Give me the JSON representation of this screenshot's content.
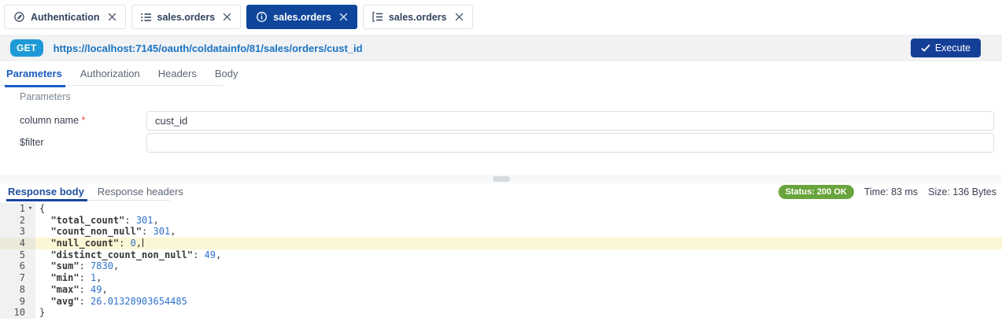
{
  "colors": {
    "active_tab_blue": "#0f469c",
    "get_badge_blue": "#1e9ad7",
    "url_blue": "#1b73c1",
    "execute_blue": "#153f97",
    "subtab_underline_blue": "#1a5dc2",
    "status_green": "#69a43c",
    "active_line_yellow": "#fbf6d3"
  },
  "tab_bar": {
    "tabs": [
      {
        "label": "Authentication",
        "icon": "auth-icon",
        "active": false
      },
      {
        "label": "sales.orders",
        "icon": "list-icon",
        "active": false
      },
      {
        "label": "sales.orders",
        "icon": "info-icon",
        "active": true
      },
      {
        "label": "sales.orders",
        "icon": "list-alt-icon",
        "active": false
      }
    ]
  },
  "request_bar": {
    "method": "GET",
    "url": "https://localhost:7145/oauth/coldatainfo/81/sales/orders/cust_id",
    "execute_label": "Execute"
  },
  "request_tabs": {
    "items": [
      {
        "label": "Parameters",
        "active": true
      },
      {
        "label": "Authorization",
        "active": false
      },
      {
        "label": "Headers",
        "active": false
      },
      {
        "label": "Body",
        "active": false
      }
    ]
  },
  "parameters_panel": {
    "section_title": "Parameters",
    "fields": [
      {
        "label": "column name",
        "required": true,
        "value": "cust_id"
      },
      {
        "label": "$filter",
        "required": false,
        "value": ""
      }
    ]
  },
  "response_panel": {
    "tabs": [
      {
        "label": "Response body",
        "active": true
      },
      {
        "label": "Response headers",
        "active": false
      }
    ],
    "status_badge": "Status: 200 OK",
    "time_label": "Time: 83 ms",
    "size_label": "Size: 136 Bytes",
    "body_json": {
      "total_count": 301,
      "count_non_null": 301,
      "null_count": 0,
      "distinct_count_non_null": 49,
      "sum": 7830,
      "min": 1,
      "max": 49,
      "avg": 26.01328903654485
    },
    "code_lines": [
      {
        "num": 1,
        "fold": true,
        "tokens": [
          [
            "punct",
            "{"
          ]
        ]
      },
      {
        "num": 2,
        "tokens": [
          [
            "punct",
            "  "
          ],
          [
            "key",
            "\"total_count\""
          ],
          [
            "punct",
            ": "
          ],
          [
            "num",
            "301"
          ],
          [
            "punct",
            ","
          ]
        ]
      },
      {
        "num": 3,
        "tokens": [
          [
            "punct",
            "  "
          ],
          [
            "key",
            "\"count_non_null\""
          ],
          [
            "punct",
            ": "
          ],
          [
            "num",
            "301"
          ],
          [
            "punct",
            ","
          ]
        ]
      },
      {
        "num": 4,
        "highlight": true,
        "cursor": true,
        "tokens": [
          [
            "punct",
            "  "
          ],
          [
            "key",
            "\"null_count\""
          ],
          [
            "punct",
            ": "
          ],
          [
            "num",
            "0"
          ],
          [
            "punct",
            ","
          ]
        ]
      },
      {
        "num": 5,
        "tokens": [
          [
            "punct",
            "  "
          ],
          [
            "key",
            "\"distinct_count_non_null\""
          ],
          [
            "punct",
            ": "
          ],
          [
            "num",
            "49"
          ],
          [
            "punct",
            ","
          ]
        ]
      },
      {
        "num": 6,
        "tokens": [
          [
            "punct",
            "  "
          ],
          [
            "key",
            "\"sum\""
          ],
          [
            "punct",
            ": "
          ],
          [
            "num",
            "7830"
          ],
          [
            "punct",
            ","
          ]
        ]
      },
      {
        "num": 7,
        "tokens": [
          [
            "punct",
            "  "
          ],
          [
            "key",
            "\"min\""
          ],
          [
            "punct",
            ": "
          ],
          [
            "num",
            "1"
          ],
          [
            "punct",
            ","
          ]
        ]
      },
      {
        "num": 8,
        "tokens": [
          [
            "punct",
            "  "
          ],
          [
            "key",
            "\"max\""
          ],
          [
            "punct",
            ": "
          ],
          [
            "num",
            "49"
          ],
          [
            "punct",
            ","
          ]
        ]
      },
      {
        "num": 9,
        "tokens": [
          [
            "punct",
            "  "
          ],
          [
            "key",
            "\"avg\""
          ],
          [
            "punct",
            ": "
          ],
          [
            "num",
            "26.01328903654485"
          ]
        ]
      },
      {
        "num": 10,
        "tokens": [
          [
            "punct",
            "}"
          ]
        ]
      }
    ]
  }
}
